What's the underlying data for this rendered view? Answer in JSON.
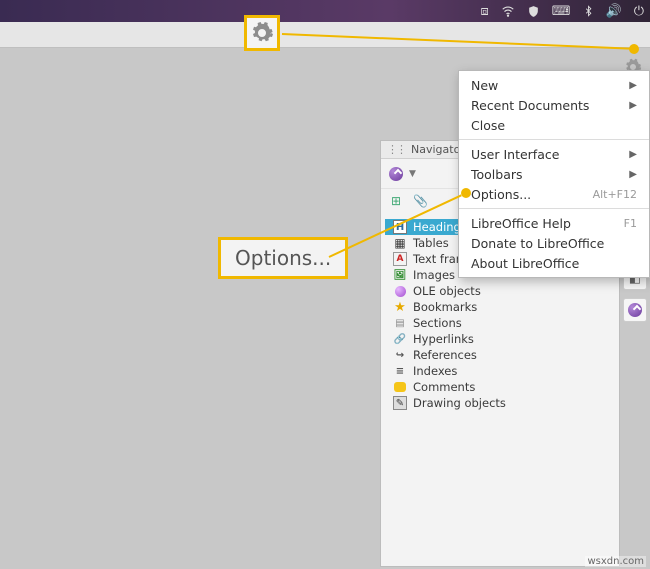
{
  "panel_icons": [
    "dropbox-icon",
    "wifi-icon",
    "shield-icon",
    "keyboard-icon",
    "bluetooth-icon",
    "volume-icon",
    "power-icon"
  ],
  "callouts": {
    "gear_label": "",
    "options_label": "Options..."
  },
  "navigator": {
    "title": "Navigator",
    "items": [
      {
        "label": "Headings",
        "icon": "heading-icon",
        "selected": true
      },
      {
        "label": "Tables",
        "icon": "table-icon",
        "selected": false
      },
      {
        "label": "Text frames",
        "icon": "textframe-icon",
        "selected": false
      },
      {
        "label": "Images",
        "icon": "image-icon",
        "selected": false
      },
      {
        "label": "OLE objects",
        "icon": "ole-icon",
        "selected": false
      },
      {
        "label": "Bookmarks",
        "icon": "bookmark-icon",
        "selected": false
      },
      {
        "label": "Sections",
        "icon": "section-icon",
        "selected": false
      },
      {
        "label": "Hyperlinks",
        "icon": "hyperlink-icon",
        "selected": false
      },
      {
        "label": "References",
        "icon": "reference-icon",
        "selected": false
      },
      {
        "label": "Indexes",
        "icon": "index-icon",
        "selected": false
      },
      {
        "label": "Comments",
        "icon": "comment-icon",
        "selected": false
      },
      {
        "label": "Drawing objects",
        "icon": "drawing-icon",
        "selected": false
      }
    ]
  },
  "menu": {
    "items": [
      {
        "label": "New",
        "submenu": true
      },
      {
        "label": "Recent Documents",
        "submenu": true
      },
      {
        "label": "Close"
      },
      {
        "sep": true
      },
      {
        "label": "User Interface",
        "submenu": true
      },
      {
        "label": "Toolbars",
        "submenu": true
      },
      {
        "label": "Options...",
        "shortcut": "Alt+F12"
      },
      {
        "sep": true
      },
      {
        "label": "LibreOffice Help",
        "shortcut": "F1"
      },
      {
        "label": "Donate to LibreOffice"
      },
      {
        "label": "About LibreOffice"
      }
    ]
  },
  "watermark": "wsxdn.com"
}
